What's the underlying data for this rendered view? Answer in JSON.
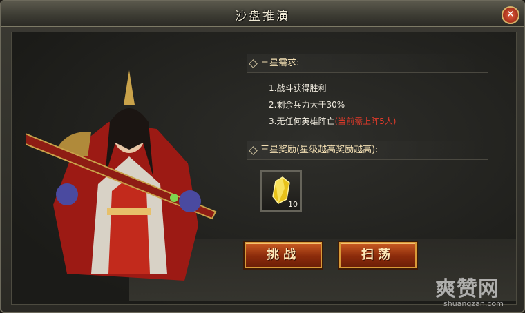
{
  "window": {
    "title": "沙盘推演",
    "close_symbol": "✕"
  },
  "requirements": {
    "header": "三星需求:",
    "items": [
      {
        "text": "1.战斗获得胜利",
        "warn": ""
      },
      {
        "text": "2.剩余兵力大于30%",
        "warn": ""
      },
      {
        "text": "3.无任何英雄阵亡",
        "warn": "(当前需上阵5人)"
      }
    ]
  },
  "rewards": {
    "header": "三星奖励(星级越高奖励越高):",
    "items": [
      {
        "icon": "yellow-gem-icon",
        "count": "10"
      }
    ]
  },
  "buttons": {
    "challenge": "挑战",
    "sweep": "扫荡"
  },
  "watermark": {
    "main": "爽赞网",
    "sub": "shuangzan.com"
  },
  "colors": {
    "accent": "#d89a38",
    "warning": "#e03a2a",
    "text": "#f1ece0"
  }
}
